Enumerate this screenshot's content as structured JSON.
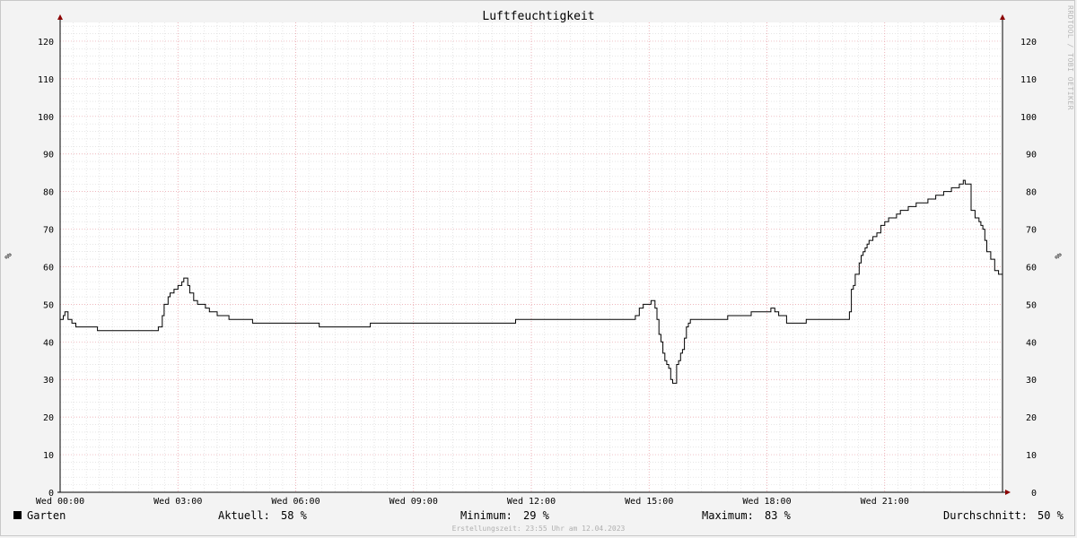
{
  "chart_data": {
    "type": "line",
    "title": "Luftfeuchtigkeit",
    "ylabel": "%",
    "ylim": [
      0,
      125
    ],
    "y_ticks": [
      0,
      10,
      20,
      30,
      40,
      50,
      60,
      70,
      80,
      90,
      100,
      110,
      120
    ],
    "x_ticks": [
      "Wed 00:00",
      "Wed 03:00",
      "Wed 06:00",
      "Wed 09:00",
      "Wed 12:00",
      "Wed 15:00",
      "Wed 18:00",
      "Wed 21:00"
    ],
    "x_range_hours": [
      0,
      24
    ],
    "grid": true,
    "series": [
      {
        "name": "Garten",
        "color": "#000000",
        "x_hours": [
          0.0,
          0.08,
          0.12,
          0.16,
          0.2,
          0.25,
          0.3,
          0.35,
          0.4,
          0.9,
          0.95,
          2.45,
          2.5,
          2.55,
          2.6,
          2.65,
          2.7,
          2.75,
          2.8,
          2.85,
          2.9,
          2.95,
          3.0,
          3.05,
          3.1,
          3.15,
          3.2,
          3.25,
          3.3,
          3.35,
          3.4,
          3.45,
          3.5,
          3.55,
          3.6,
          3.7,
          3.8,
          3.9,
          4.0,
          4.15,
          4.3,
          4.5,
          4.7,
          4.9,
          5.3,
          5.5,
          6.5,
          6.6,
          6.7,
          7.8,
          7.9,
          8.0,
          9.0,
          10.0,
          11.0,
          11.5,
          11.6,
          12.0,
          13.0,
          14.0,
          14.5,
          14.65,
          14.75,
          14.85,
          14.95,
          15.05,
          15.15,
          15.2,
          15.25,
          15.3,
          15.35,
          15.4,
          15.45,
          15.5,
          15.55,
          15.6,
          15.65,
          15.7,
          15.75,
          15.8,
          15.85,
          15.9,
          15.95,
          16.0,
          16.05,
          16.1,
          16.2,
          16.3,
          16.5,
          17.0,
          17.3,
          17.6,
          17.7,
          17.9,
          18.0,
          18.1,
          18.2,
          18.3,
          18.5,
          18.8,
          19.0,
          19.5,
          20.0,
          20.1,
          20.15,
          20.2,
          20.25,
          20.3,
          20.35,
          20.4,
          20.45,
          20.5,
          20.55,
          20.6,
          20.65,
          20.7,
          20.75,
          20.8,
          20.9,
          21.0,
          21.1,
          21.2,
          21.3,
          21.4,
          21.5,
          21.6,
          21.7,
          21.8,
          22.0,
          22.1,
          22.2,
          22.3,
          22.4,
          22.5,
          22.6,
          22.7,
          22.8,
          22.85,
          22.9,
          22.95,
          23.0,
          23.05,
          23.1,
          23.2,
          23.3,
          23.4,
          23.45,
          23.5,
          23.55,
          23.6,
          23.7,
          23.8,
          23.9,
          24.0
        ],
        "values": [
          46,
          47,
          48,
          48,
          46,
          46,
          45,
          45,
          44,
          44,
          43,
          43,
          44,
          44,
          47,
          50,
          50,
          52,
          53,
          53,
          54,
          54,
          55,
          55,
          56,
          57,
          57,
          55,
          53,
          53,
          51,
          51,
          50,
          50,
          50,
          49,
          48,
          48,
          47,
          47,
          46,
          46,
          46,
          45,
          45,
          45,
          45,
          44,
          44,
          44,
          45,
          45,
          45,
          45,
          45,
          45,
          46,
          46,
          46,
          46,
          46,
          47,
          49,
          50,
          50,
          51,
          49,
          46,
          42,
          40,
          37,
          35,
          34,
          33,
          30,
          29,
          29,
          34,
          35,
          37,
          38,
          41,
          44,
          45,
          46,
          46,
          46,
          46,
          46,
          47,
          47,
          48,
          48,
          48,
          48,
          49,
          48,
          47,
          45,
          45,
          46,
          46,
          46,
          48,
          54,
          55,
          58,
          58,
          61,
          63,
          64,
          65,
          66,
          67,
          67,
          68,
          68,
          69,
          71,
          72,
          73,
          73,
          74,
          75,
          75,
          76,
          76,
          77,
          77,
          78,
          78,
          79,
          79,
          80,
          80,
          81,
          81,
          81,
          82,
          82,
          83,
          82,
          82,
          75,
          73,
          72,
          71,
          70,
          67,
          64,
          62,
          59,
          58
        ]
      }
    ]
  },
  "legend": {
    "series_label": "Garten",
    "current_label": "Aktuell:",
    "current_value": "58 %",
    "min_label": "Minimum:",
    "min_value": "29 %",
    "max_label": "Maximum:",
    "max_value": "83 %",
    "avg_label": "Durchschnitt:",
    "avg_value": "50 %"
  },
  "footer": "Erstellungszeit: 23:55 Uhr am 12.04.2023",
  "watermark": "RRDTOOL / TOBI OETIKER",
  "colors": {
    "background": "#f3f3f3",
    "plot_background": "#ffffff",
    "grid_major_vertical": "#e8a0a8",
    "grid_minor": "#d8d8d8",
    "axis": "#000000",
    "arrow": "#8b0000"
  }
}
